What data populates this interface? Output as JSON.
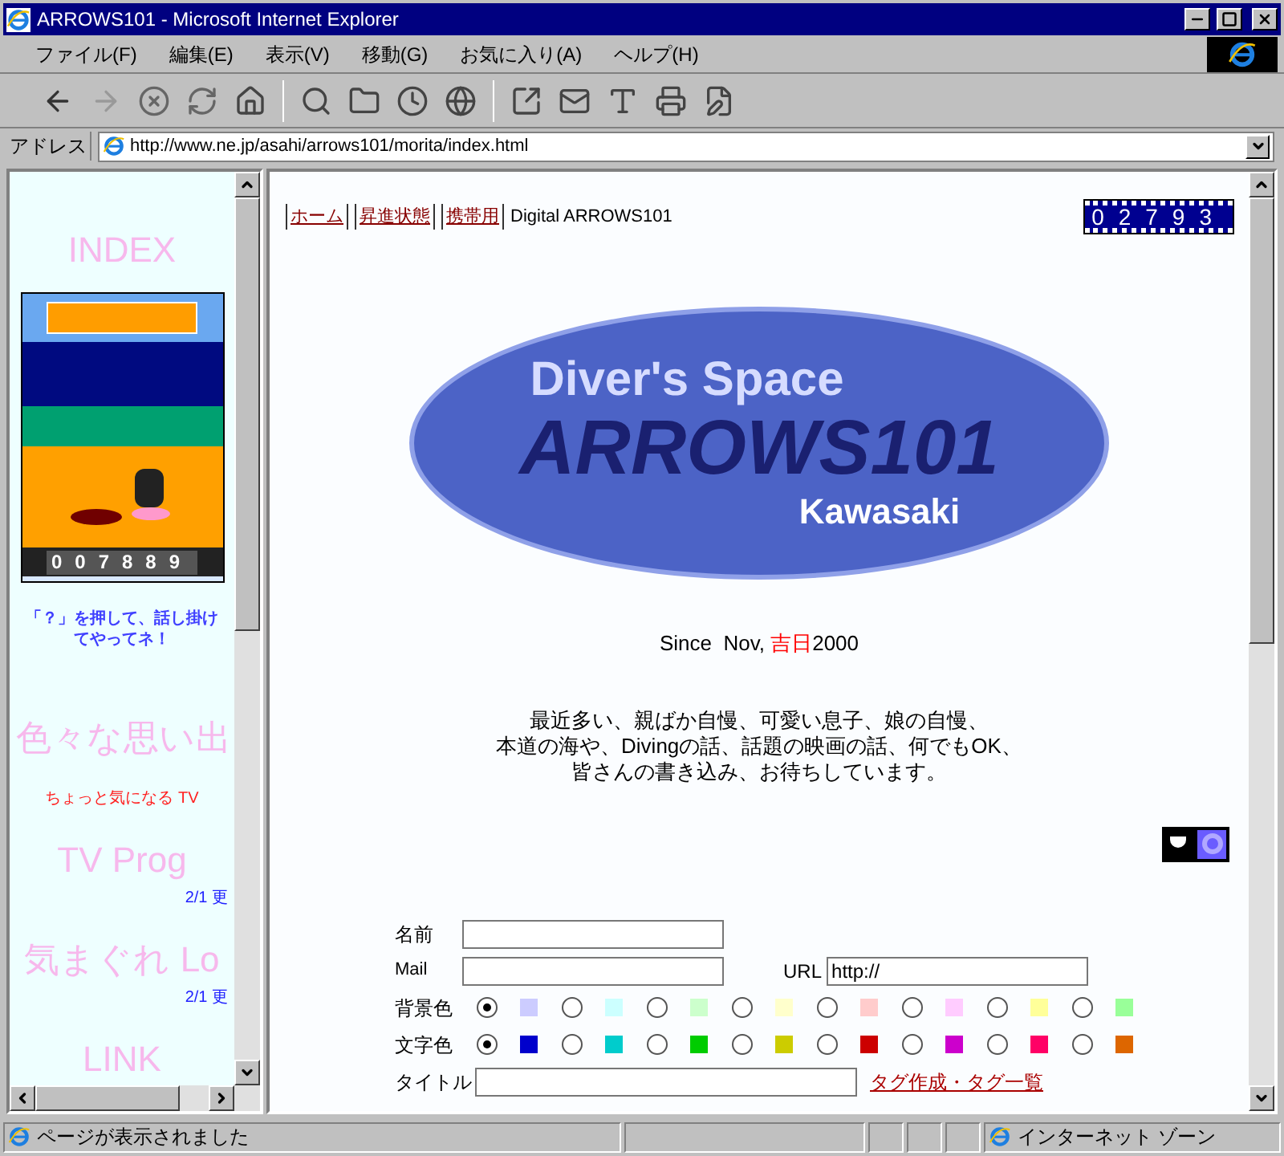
{
  "window": {
    "title": "ARROWS101 - Microsoft Internet Explorer"
  },
  "menu": [
    "ファイル(F)",
    "編集(E)",
    "表示(V)",
    "移動(G)",
    "お気に入り(A)",
    "ヘルプ(H)"
  ],
  "address": {
    "label": "アドレス",
    "url": "http://www.ne.jp/asahi/arrows101/morita/index.html"
  },
  "sidebar": {
    "heading": "INDEX",
    "counter": "007889",
    "caption": "「？」を押して、話し掛けてやってネ！",
    "items": [
      {
        "kind": "heading",
        "text": "色々な思い出"
      },
      {
        "kind": "note",
        "text": "ちょっと気になる TV"
      },
      {
        "kind": "heading",
        "text": "TV Prog"
      },
      {
        "kind": "update",
        "text": "2/1 更"
      },
      {
        "kind": "heading",
        "text": "気まぐれ Lo"
      },
      {
        "kind": "update",
        "text": "2/1 更"
      },
      {
        "kind": "heading",
        "text": "LINK"
      }
    ]
  },
  "page": {
    "links": [
      {
        "label": "ホーム"
      },
      {
        "label": "昇進状態"
      },
      {
        "label": "携帯用"
      }
    ],
    "site_name": "Digital ARROWS101",
    "counter": "02793",
    "logo": {
      "line1": "Diver's Space",
      "line2": "ARROWS101",
      "line3": "Kawasaki"
    },
    "since": {
      "prefix": "Since  Nov, ",
      "highlight": "吉日",
      "suffix": "2000"
    },
    "message": [
      "最近多い、親ばか自慢、可愛い息子、娘の自慢、",
      "本道の海や、Divingの話、話題の映画の話、何でもOK、",
      "皆さんの書き込み、お待ちしています。"
    ],
    "form": {
      "name_label": "名前",
      "mail_label": "Mail",
      "url_label": "URL",
      "url_value": "http://",
      "bg_label": "背景色",
      "bg_colors": [
        {
          "color": "#ccccff",
          "selected": true
        },
        {
          "color": "#ccffff",
          "selected": false
        },
        {
          "color": "#ccffcc",
          "selected": false
        },
        {
          "color": "#ffffcc",
          "selected": false
        },
        {
          "color": "#ffcccc",
          "selected": false
        },
        {
          "color": "#ffccff",
          "selected": false
        },
        {
          "color": "#ffff99",
          "selected": false
        },
        {
          "color": "#99ff99",
          "selected": false
        }
      ],
      "text_label": "文字色",
      "text_colors": [
        {
          "color": "#0000cc",
          "selected": true
        },
        {
          "color": "#00cccc",
          "selected": false
        },
        {
          "color": "#00cc00",
          "selected": false
        },
        {
          "color": "#cccc00",
          "selected": false
        },
        {
          "color": "#cc0000",
          "selected": false
        },
        {
          "color": "#cc00cc",
          "selected": false
        },
        {
          "color": "#ff0066",
          "selected": false
        },
        {
          "color": "#dd6600",
          "selected": false
        }
      ],
      "title_label": "タイトル",
      "tag_link": "タグ作成・タグ一覧"
    }
  },
  "status": {
    "text": "ページが表示されました",
    "zone": "インターネット ゾーン"
  }
}
